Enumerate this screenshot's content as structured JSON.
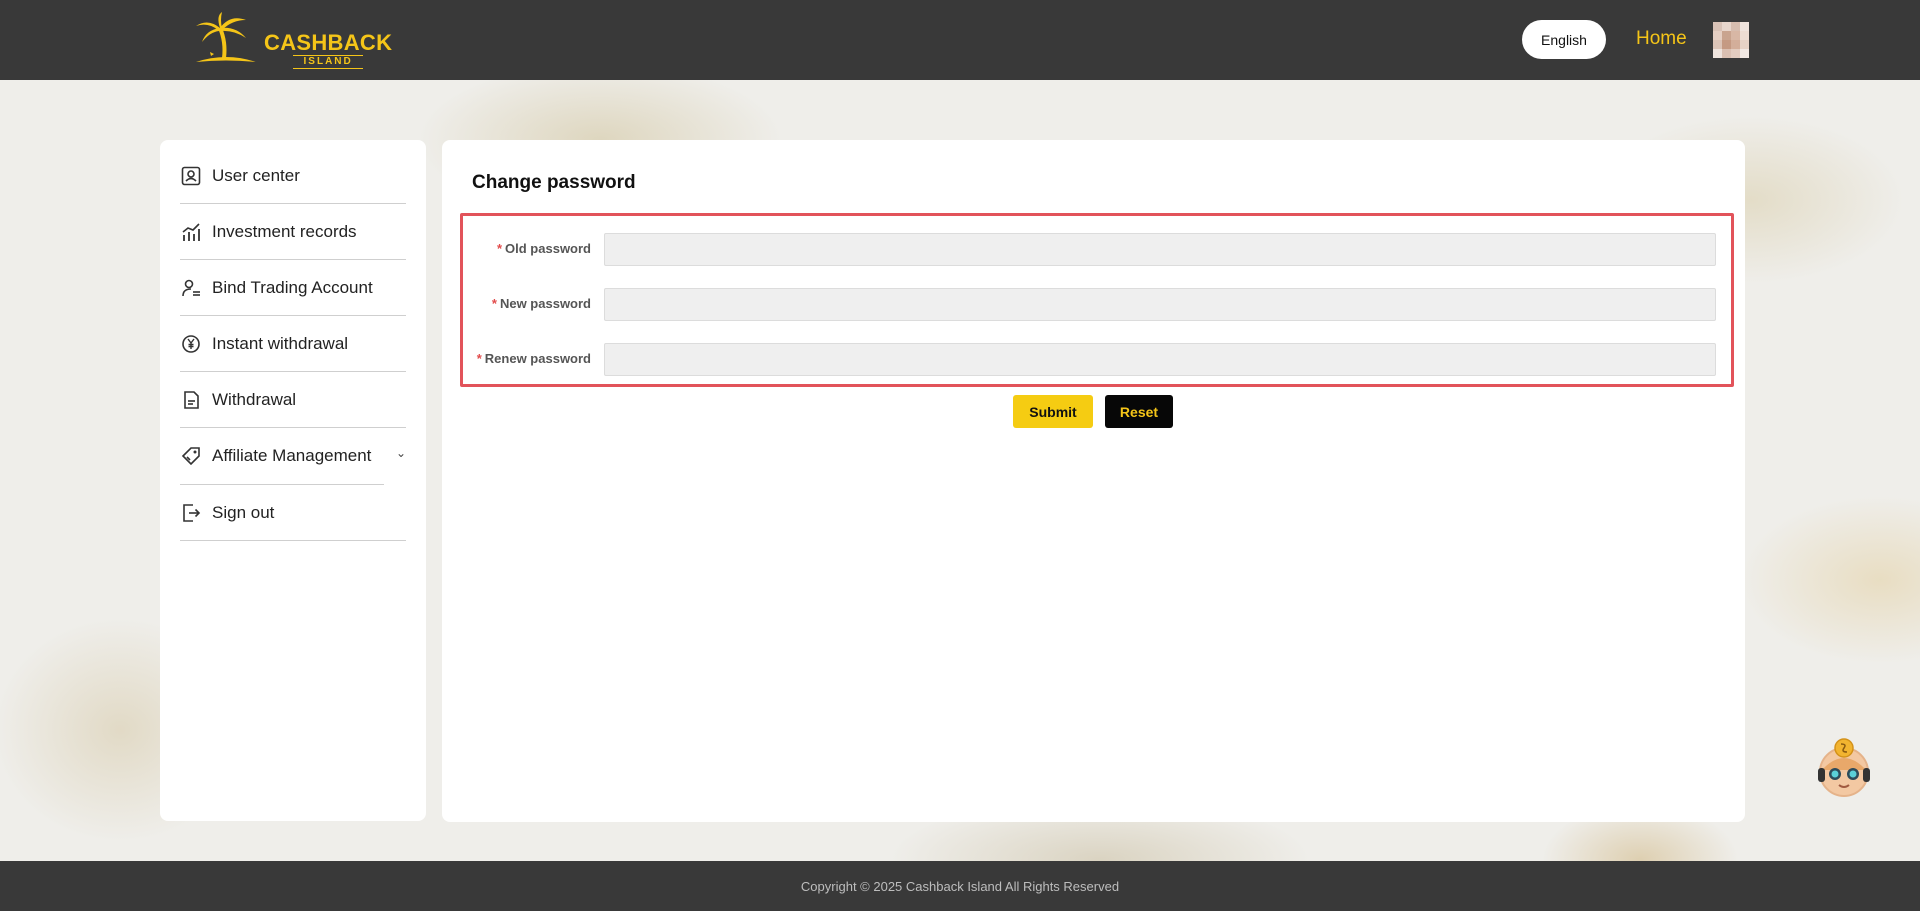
{
  "header": {
    "logo_main": "CASHBACK",
    "logo_sub": "ISLAND",
    "language_label": "English",
    "home_label": "Home"
  },
  "sidebar": {
    "items": [
      {
        "label": "User center",
        "icon": "user-badge-icon"
      },
      {
        "label": "Investment records",
        "icon": "chart-icon"
      },
      {
        "label": "Bind Trading Account",
        "icon": "user-link-icon"
      },
      {
        "label": "Instant withdrawal",
        "icon": "yen-coin-icon"
      },
      {
        "label": "Withdrawal",
        "icon": "document-icon"
      },
      {
        "label": "Affiliate Management",
        "icon": "tag-icon"
      },
      {
        "label": "Sign out",
        "icon": "sign-out-icon"
      }
    ]
  },
  "main": {
    "title": "Change password",
    "fields": [
      {
        "required_mark": "*",
        "label": "Old password",
        "value": ""
      },
      {
        "required_mark": "*",
        "label": "New password",
        "value": ""
      },
      {
        "required_mark": "*",
        "label": "Renew password",
        "value": ""
      }
    ],
    "submit_label": "Submit",
    "reset_label": "Reset"
  },
  "footer": {
    "copyright": "Copyright © 2025 Cashback Island All Rights Reserved"
  },
  "colors": {
    "accent": "#f5c518",
    "header_bg": "#393939",
    "highlight_border": "#e2535a"
  }
}
